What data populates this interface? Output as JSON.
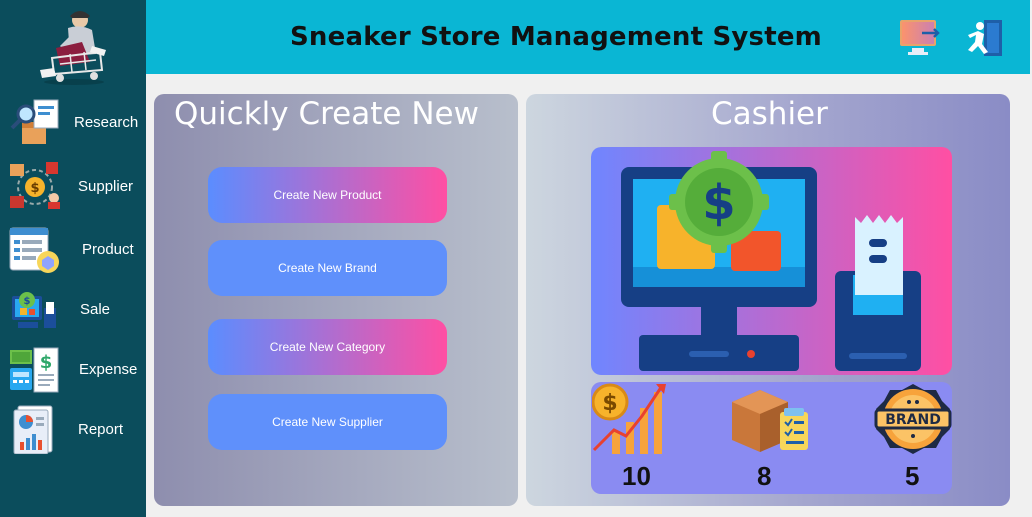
{
  "header": {
    "title": "Sneaker Store Management System"
  },
  "sidebar": {
    "items": [
      {
        "label": "Research"
      },
      {
        "label": "Supplier"
      },
      {
        "label": "Product"
      },
      {
        "label": "Sale"
      },
      {
        "label": "Expense"
      },
      {
        "label": "Report"
      }
    ]
  },
  "quick_create": {
    "title": "Quickly Create New",
    "buttons": [
      {
        "label": "Create New Product"
      },
      {
        "label": "Create New Brand"
      },
      {
        "label": "Create New Category"
      },
      {
        "label": "Create New Supplier"
      }
    ]
  },
  "cashier": {
    "title": "Cashier",
    "stats": [
      {
        "icon": "revenue-chart-icon",
        "value": "10"
      },
      {
        "icon": "product-box-icon",
        "value": "8"
      },
      {
        "icon": "brand-badge-icon",
        "value": "5"
      }
    ]
  },
  "colors": {
    "sidebar": "#0b4d5c",
    "header": "#0ab6d4",
    "button_blue": "#5f90fb",
    "button_pink": "#ff4fa3",
    "stats_bar": "#8a8bf2"
  }
}
